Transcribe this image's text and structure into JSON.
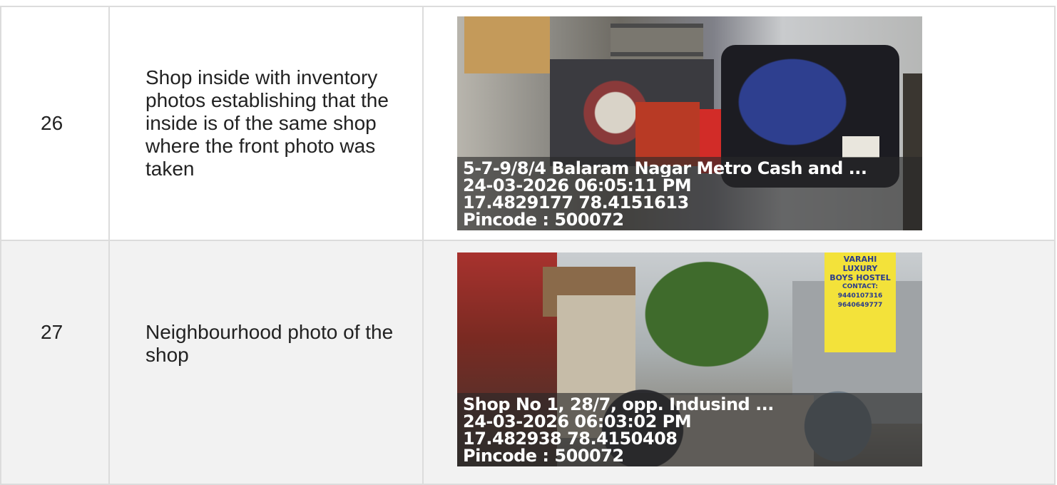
{
  "rows": [
    {
      "number": "26",
      "description": "Shop inside with inventory photos establishing that the inside is of the same shop where the front photo was taken",
      "photo": {
        "address": "5-7-9/8/4 Balaram Nagar Metro Cash and ...",
        "timestamp": "24-03-2026 06:05:11 PM",
        "coordinates": "17.4829177 78.4151613",
        "pincode": "Pincode : 500072"
      }
    },
    {
      "number": "27",
      "description": "Neighbourhood photo of the shop",
      "photo": {
        "address": "Shop No 1, 28/7, opp. Indusind ...",
        "timestamp": "24-03-2026 06:03:02 PM",
        "coordinates": "17.482938 78.4150408",
        "pincode": "Pincode : 500072",
        "signboard": [
          "VARAHI",
          "LUXURY",
          "BOYS HOSTEL",
          "CONTACT:",
          "9440107316",
          "9640649777"
        ]
      }
    }
  ]
}
